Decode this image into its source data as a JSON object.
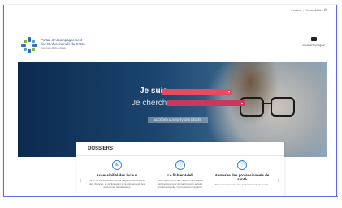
{
  "topbar": {
    "link1": "Contact",
    "sep": "|",
    "link2": "Accessibilité",
    "gear_icon": "gear-icon"
  },
  "header": {
    "logo_line1": "Portail d'Accompagnement",
    "logo_line2": "des Professionnels de Santé",
    "logo_line3": "Auvergne-Rhône-Alpes",
    "account_label": "GUICHET UNIQUE",
    "account_icon": "envelope-icon"
  },
  "hero": {
    "je_suis": "Je suis",
    "je_cherche": "Je cherche",
    "select_suis_arrow": "▾",
    "select_cherche_arrow": "▾",
    "cta": "ACCÉDER AUX SERVICES DÉDIÉS"
  },
  "dossiers": {
    "title": "DOSSIERS",
    "items": [
      {
        "icon": "accessibility-icon",
        "title": "Accessibilité des locaux",
        "desc": "La loi du 11 février 2005 pour l'égalité des droits et des chances, la participation et la citoyenneté des personnes handicapées"
      },
      {
        "icon": "info-icon",
        "title": "Le fichier Adeli",
        "desc": "Description du fichier Adeli et des étapes obligatoires pour démarrer votre activité professionnelle. Comment s'enregistrer"
      },
      {
        "icon": "info-icon",
        "title": "Annuaire des professionnels de santé",
        "desc": "Retrouvez à la liste des professionnels de santé."
      }
    ],
    "prev_arrow": "‹",
    "next_arrow": "›"
  }
}
